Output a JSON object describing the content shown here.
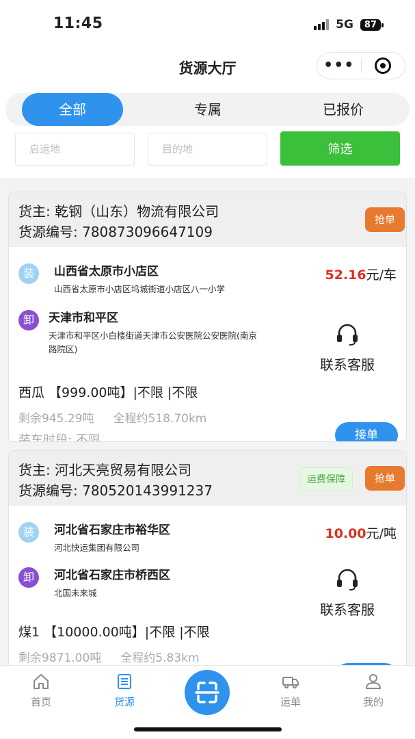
{
  "status_bar": {
    "time": "11:45",
    "network": "5G",
    "battery": "87"
  },
  "navbar": {
    "title": "货源大厅",
    "more_label": "•••"
  },
  "tabs": [
    {
      "label": "全部",
      "active": true
    },
    {
      "label": "专属",
      "active": false
    },
    {
      "label": "已报价",
      "active": false
    }
  ],
  "filters": {
    "origin_placeholder": "启运地",
    "destination_placeholder": "目的地",
    "filter_button": "筛选"
  },
  "colors": {
    "primary": "#2f93ee",
    "filter_green": "#3cbf3a",
    "grab_orange": "#e77a2e",
    "price_red": "#e0301e"
  },
  "cards": [
    {
      "shipper": "货主: 乾钢（山东）物流有限公司",
      "source_no": "货源编号: 780873096647109",
      "grab_label": "抢单",
      "load_badge": "装",
      "load_city": "山西省太原市小店区",
      "load_addr": "山西省太原市小店区坞城街道小店区八一小学",
      "price_value": "52.16",
      "price_unit": "元/车",
      "unload_badge": "卸",
      "unload_city": "天津市和平区",
      "unload_addr": "天津市和平区小白楼街道天津市公安医院公安医院(南京路院区)",
      "service_label": "联系客服",
      "goods": "西瓜 【999.00吨】|不限 |不限",
      "remaining": "剩余945.29吨",
      "distance": "全程约518.70km",
      "loading_period": "装车时段:  不限",
      "accept_label": "接单"
    },
    {
      "shipper": "货主: 河北天亮贸易有限公司",
      "source_no": "货源编号: 780520143991237",
      "guarantee_label": "运费保障",
      "grab_label": "抢单",
      "load_badge": "装",
      "load_city": "河北省石家庄市裕华区",
      "load_addr": "河北快运集团有限公司",
      "price_value": "10.00",
      "price_unit": "元/吨",
      "unload_badge": "卸",
      "unload_city": "河北省石家庄市桥西区",
      "unload_addr": "北国未来城",
      "service_label": "联系客服",
      "goods": "煤1 【10000.00吨】|不限 |不限",
      "remaining": "剩余9871.00吨",
      "distance": "全程约5.83km"
    }
  ],
  "tabbar": [
    {
      "label": "首页",
      "icon": "home-icon",
      "active": false
    },
    {
      "label": "货源",
      "icon": "list-icon",
      "active": true
    },
    {
      "label": "",
      "icon": "scan-icon",
      "active": false
    },
    {
      "label": "运单",
      "icon": "truck-icon",
      "active": false
    },
    {
      "label": "我的",
      "icon": "user-icon",
      "active": false
    }
  ]
}
